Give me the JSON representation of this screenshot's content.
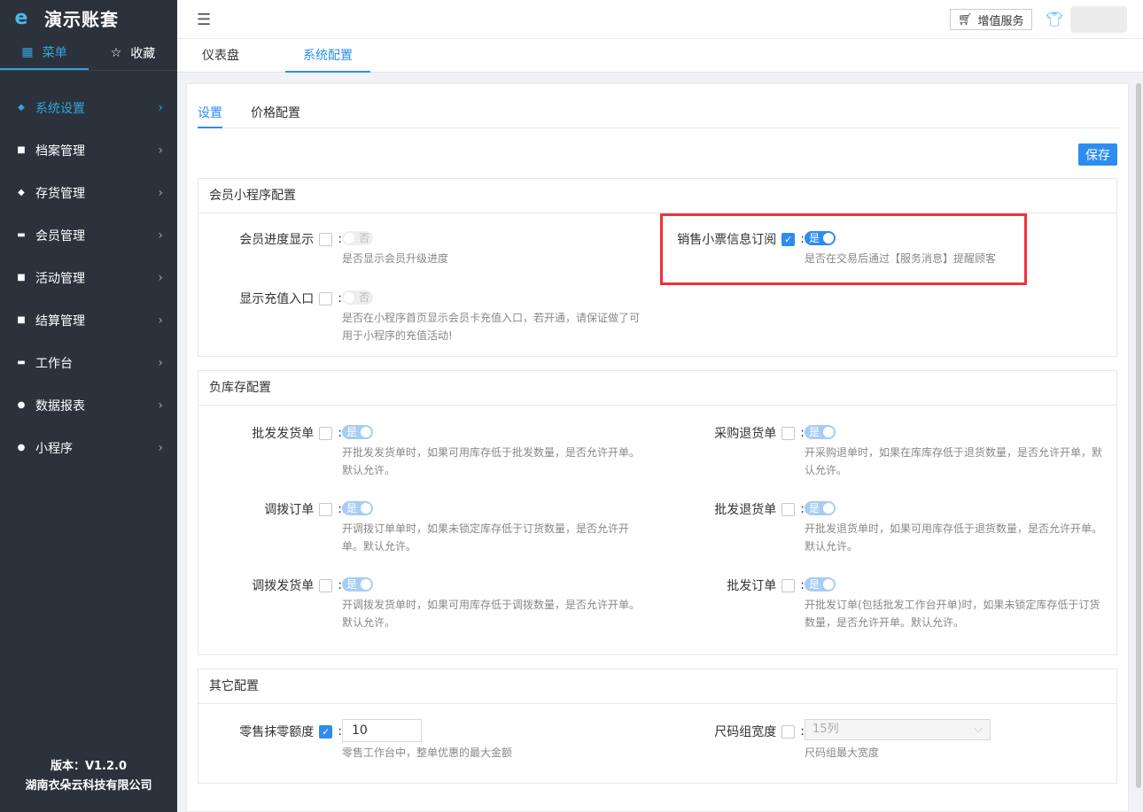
{
  "app": {
    "title": "演示账套",
    "logo_text": "e"
  },
  "sidebar": {
    "tabs": [
      {
        "label": "菜单",
        "icon": "grid-icon"
      },
      {
        "label": "收藏",
        "icon": "star-icon"
      }
    ],
    "items": [
      {
        "label": "系统设置",
        "icon": "gear-icon"
      },
      {
        "label": "档案管理",
        "icon": "archive-icon"
      },
      {
        "label": "存货管理",
        "icon": "box-icon"
      },
      {
        "label": "会员管理",
        "icon": "card-icon"
      },
      {
        "label": "活动管理",
        "icon": "gift-icon"
      },
      {
        "label": "结算管理",
        "icon": "register-icon"
      },
      {
        "label": "工作台",
        "icon": "monitor-icon"
      },
      {
        "label": "数据报表",
        "icon": "pie-icon"
      },
      {
        "label": "小程序",
        "icon": "compass-icon"
      }
    ],
    "version": "版本：V1.2.0",
    "company": "湖南衣朵云科技有限公司"
  },
  "topbar": {
    "value_added": "增值服务"
  },
  "page_tabs": [
    "仪表盘",
    "系统配置"
  ],
  "sub_tabs": [
    "设置",
    "价格配置"
  ],
  "save_label": "保存",
  "member": {
    "title": "会员小程序配置",
    "progress": {
      "label": "会员进度显示",
      "switch": "否",
      "help": "是否显示会员升级进度"
    },
    "recharge": {
      "label": "显示充值入口",
      "switch": "否",
      "help1": "是否在小程序首页显示会员卡充值入口，若开通，请保证做了可",
      "help2": "用于小程序的充值活动!"
    },
    "receipt": {
      "label": "销售小票信息订阅",
      "switch": "是",
      "help": "是否在交易后通过【服务消息】提醒顾客"
    }
  },
  "stock": {
    "title": "负库存配置",
    "wholesale_ship": {
      "label": "批发发货单",
      "switch": "是",
      "help1": "开批发发货单时，如果可用库存低于批发数量，是否允许开单。",
      "help2": "默认允许。"
    },
    "purchase_return": {
      "label": "采购退货单",
      "switch": "是",
      "help1": "开采购退单时，如果在库库存低于退货数量，是否允许开单，默",
      "help2": "认允许。"
    },
    "transfer_order": {
      "label": "调拨订单",
      "switch": "是",
      "help1": "开调拨订单单时，如果未锁定库存低于订货数量，是否允许开",
      "help2": "单。默认允许。"
    },
    "wholesale_return": {
      "label": "批发退货单",
      "switch": "是",
      "help1": "开批发退货单时，如果可用库存低于退货数量，是否允许开单。",
      "help2": "默认允许。"
    },
    "transfer_ship": {
      "label": "调拨发货单",
      "switch": "是",
      "help1": "开调拨发货单时，如果可用库存低于调拨数量，是否允许开单。",
      "help2": "默认允许。"
    },
    "wholesale_order": {
      "label": "批发订单",
      "switch": "是",
      "help1": "开批发订单(包括批发工作台开单)时，如果未锁定库存低于订货",
      "help2": "数量，是否允许开单。默认允许。"
    }
  },
  "other": {
    "title": "其它配置",
    "rounding": {
      "label": "零售抹零额度",
      "value": "10",
      "help": "零售工作台中，整单优惠的最大金额"
    },
    "size_width": {
      "label": "尺码组宽度",
      "value": "15列",
      "help": "尺码组最大宽度"
    }
  }
}
